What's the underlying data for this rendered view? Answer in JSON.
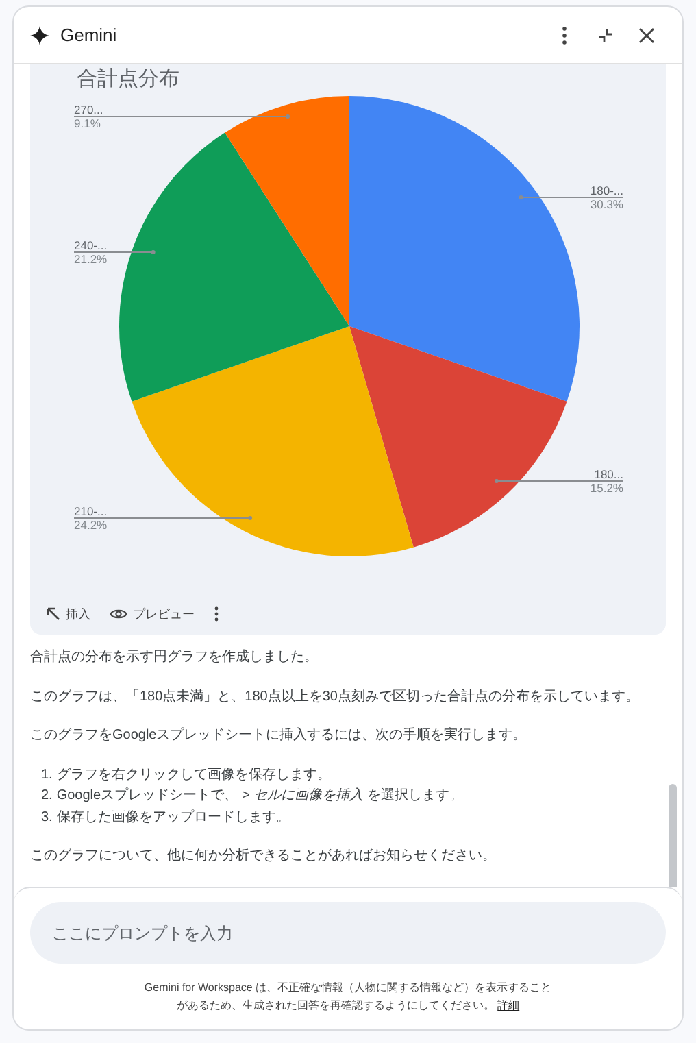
{
  "window": {
    "title": "Gemini"
  },
  "chart_panel": {
    "chart_data": {
      "type": "pie",
      "title": "合計点分布",
      "categories": [
        "180-...",
        "180...",
        "210-...",
        "240-...",
        "270..."
      ],
      "values": [
        30.3,
        15.2,
        24.2,
        21.2,
        9.1
      ],
      "colors": [
        "#4285f4",
        "#db4437",
        "#f4b400",
        "#0f9d58",
        "#ff6d00"
      ],
      "value_labels": [
        "30.3%",
        "15.2%",
        "24.2%",
        "21.2%",
        "9.1%"
      ]
    },
    "actions": [
      {
        "kind": "insert",
        "label": "挿入"
      },
      {
        "kind": "preview",
        "label": "プレビュー"
      },
      {
        "kind": "more"
      }
    ]
  },
  "response": {
    "paragraphs": [
      "合計点の分布を示す円グラフを作成しました。",
      "このグラフは、「180点未満」と、180点以上を30点刻みで区切った合計点の分布を示しています。",
      "このグラフをGoogleスプレッドシートに挿入するには、次の手順を実行します。"
    ],
    "steps": [
      {
        "number": "1.",
        "text": "グラフを右クリックして画像を保存します。"
      },
      {
        "number": "2.",
        "text": "Googleスプレッドシートで、 *> セルに画像を挿入* を選択します。"
      },
      {
        "number": "3.",
        "text": "保存した画像をアップロードします。"
      }
    ],
    "closing": "このグラフについて、他に何か分析できることがあればお知らせください。"
  },
  "prompt": {
    "placeholder": "ここにプロンプトを入力"
  },
  "disclaimer": {
    "text": "Gemini for Workspace は、不正確な情報（人物に関する情報など）を表示することがあるため、生成された回答を再確認するようにしてください。",
    "link": "詳細"
  }
}
